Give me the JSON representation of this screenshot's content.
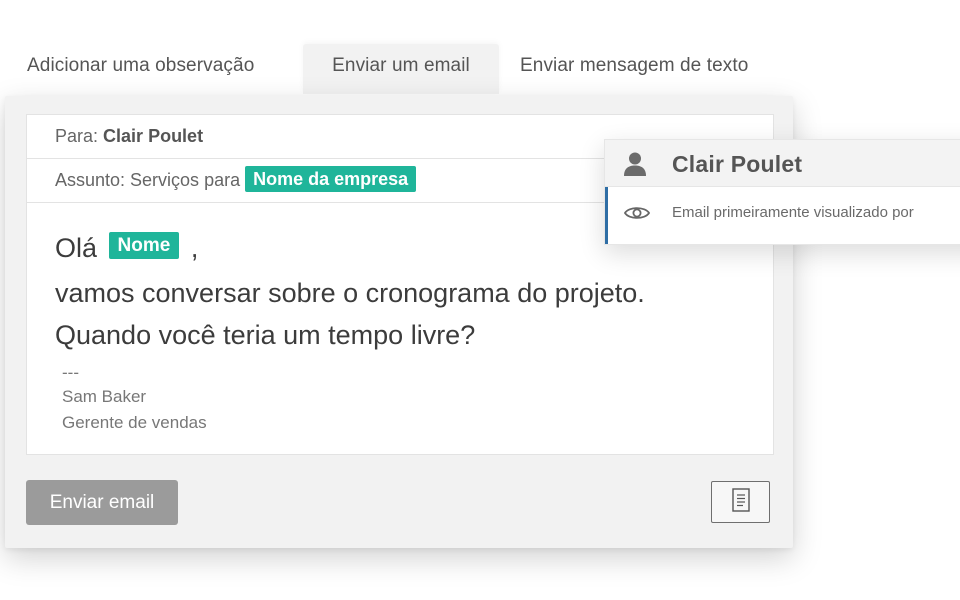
{
  "tabs": [
    {
      "label": "Adicionar uma observação",
      "active": false
    },
    {
      "label": "Enviar um email",
      "active": true
    },
    {
      "label": "Enviar mensagem de texto",
      "active": false
    }
  ],
  "email": {
    "to_label": "Para:",
    "to_name": "Clair Poulet",
    "subject_label": "Assunto: Serviços para",
    "subject_tag": "Nome da empresa",
    "greeting": "Olá",
    "greeting_tag": "Nome",
    "greeting_suffix": ",",
    "line2": "vamos conversar sobre o cronograma do projeto.",
    "line3": "Quando você teria um tempo livre?",
    "signature_sep": "---",
    "signature_name": "Sam Baker",
    "signature_title": "Gerente de vendas"
  },
  "actions": {
    "send_label": "Enviar email",
    "template_icon": "document-icon"
  },
  "popover": {
    "name": "Clair Poulet",
    "user_icon": "user-icon",
    "eye_icon": "eye-icon",
    "info": "Email primeiramente visualizado por"
  },
  "colors": {
    "tag": "#1fb59a",
    "button": "#9b9b9b",
    "accent": "#2f6ea5"
  }
}
